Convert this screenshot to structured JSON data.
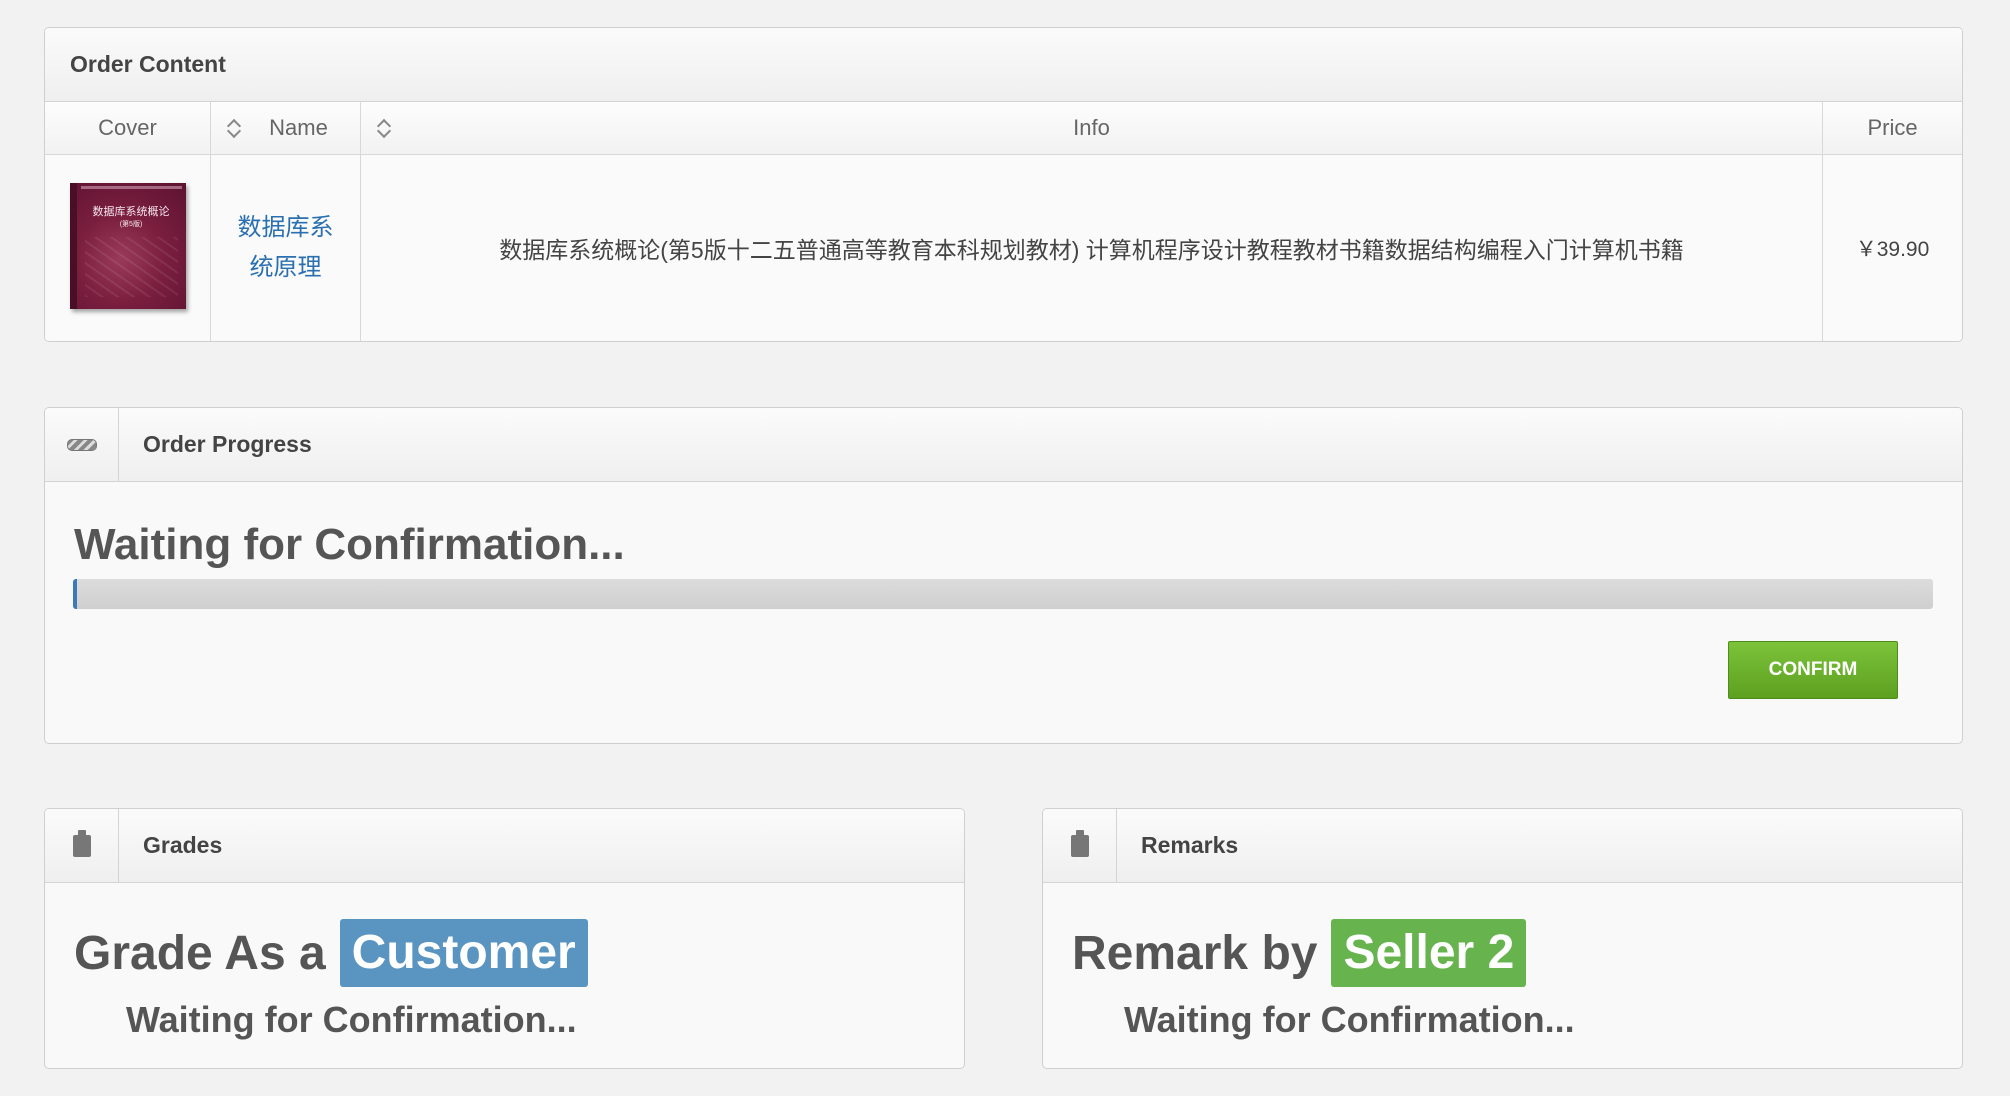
{
  "order_content": {
    "title": "Order Content",
    "columns": [
      "Cover",
      "Name",
      "Info",
      "Price"
    ],
    "row": {
      "cover_title": "数据库系统概论",
      "cover_edition": "(第5版)",
      "name": "数据库系统原理",
      "info": "数据库系统概论(第5版十二五普通高等教育本科规划教材) 计算机程序设计教程教材书籍数据结构编程入门计算机书籍",
      "price": "￥39.90"
    }
  },
  "order_progress": {
    "title": "Order Progress",
    "status": "Waiting for Confirmation...",
    "progress_fraction": 0.002,
    "confirm_label": "CONFIRM"
  },
  "grades": {
    "title": "Grades",
    "heading": "Grade As a",
    "role": "Customer",
    "status": "Waiting for Confirmation..."
  },
  "remarks": {
    "title": "Remarks",
    "heading": "Remark by",
    "role": "Seller 2",
    "status": "Waiting for Confirmation..."
  }
}
